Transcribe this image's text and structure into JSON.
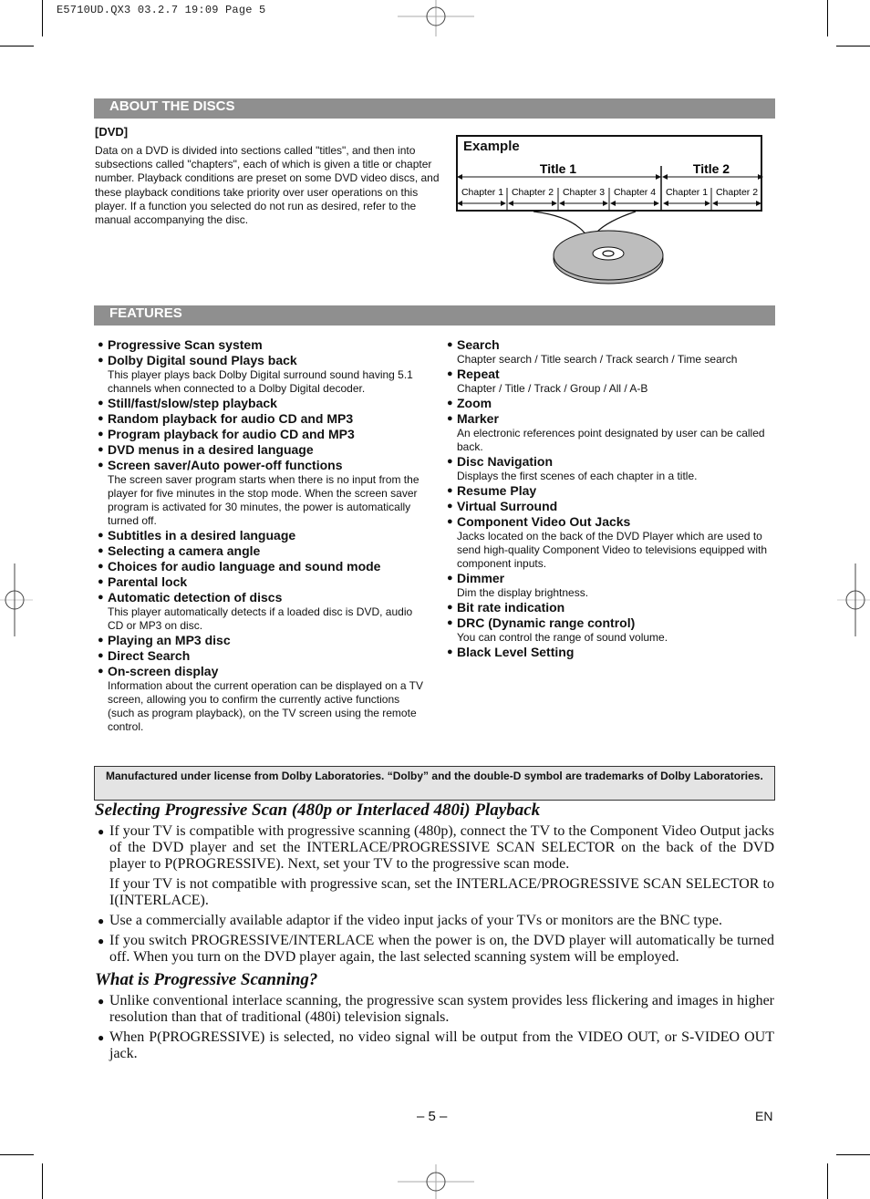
{
  "slug": "E5710UD.QX3  03.2.7 19:09  Page 5",
  "about": {
    "heading": "ABOUT THE DISCS",
    "dvd_label": "[DVD]",
    "dvd_text": "Data on a DVD is divided into sections called \"titles\", and then into subsections called \"chapters\", each of which is given a title or chapter number. Playback conditions are preset on some DVD video discs, and these playback conditions take priority over user operations on this player. If a function you selected do not run as desired, refer to the manual accompanying the disc.",
    "example": {
      "label": "Example",
      "titles": [
        "Title 1",
        "Title 2"
      ],
      "chapters": [
        "Chapter 1",
        "Chapter 2",
        "Chapter 3",
        "Chapter 4",
        "Chapter 1",
        "Chapter 2"
      ],
      "disc_icon": "dvd-disc-icon"
    }
  },
  "features": {
    "heading": "FEATURES",
    "left": [
      {
        "title": "Progressive Scan system",
        "desc": ""
      },
      {
        "title": "Dolby Digital sound Plays back",
        "desc": "This player plays back Dolby Digital surround sound having 5.1 channels when connected to a Dolby Digital decoder."
      },
      {
        "title": "Still/fast/slow/step playback",
        "desc": ""
      },
      {
        "title": "Random playback for audio CD and MP3",
        "desc": ""
      },
      {
        "title": "Program playback for audio CD and MP3",
        "desc": ""
      },
      {
        "title": "DVD menus in a desired language",
        "desc": ""
      },
      {
        "title": "Screen saver/Auto power-off functions",
        "desc": "The screen saver program starts when there is no input from the player for five minutes in the stop mode.  When the screen saver program is activated for 30 minutes, the power is automatically turned off."
      },
      {
        "title": "Subtitles in a desired language",
        "desc": ""
      },
      {
        "title": "Selecting a camera angle",
        "desc": ""
      },
      {
        "title": "Choices for audio language and sound mode",
        "desc": ""
      },
      {
        "title": "Parental lock",
        "desc": ""
      },
      {
        "title": "Automatic detection of discs",
        "desc": "This player automatically detects if a loaded disc is DVD, audio CD or MP3 on disc."
      },
      {
        "title": "Playing an MP3 disc",
        "desc": ""
      },
      {
        "title": "Direct Search",
        "desc": ""
      },
      {
        "title": "On-screen display",
        "desc": "Information about the current operation can be displayed on a TV screen, allowing you to confirm the currently active functions (such as program playback), on the TV screen using the remote control."
      }
    ],
    "right": [
      {
        "title": "Search",
        "desc": "Chapter search / Title search / Track search / Time search"
      },
      {
        "title": "Repeat",
        "desc": "Chapter / Title / Track / Group / All / A-B"
      },
      {
        "title": "Zoom",
        "desc": ""
      },
      {
        "title": "Marker",
        "desc": "An electronic references point designated by user can be called back."
      },
      {
        "title": "Disc Navigation",
        "desc": "Displays the first scenes of each chapter in a title."
      },
      {
        "title": "Resume Play",
        "desc": ""
      },
      {
        "title": "Virtual Surround",
        "desc": ""
      },
      {
        "title": "Component Video Out Jacks",
        "desc": "Jacks located on the back of the DVD Player which are used to send high-quality Component Video to televisions equipped with component inputs."
      },
      {
        "title": "Dimmer",
        "desc": "Dim the display brightness."
      },
      {
        "title": "Bit rate indication",
        "desc": ""
      },
      {
        "title": "DRC (Dynamic range control)",
        "desc": "You can control the range of sound volume."
      },
      {
        "title": "Black Level Setting",
        "desc": ""
      }
    ]
  },
  "dolby_notice": "Manufactured under license from Dolby Laboratories. “Dolby” and the double-D symbol are trademarks of Dolby Laboratories.",
  "progressive": {
    "heading": "Selecting Progressive Scan (480p or Interlaced 480i) Playback",
    "items": [
      {
        "paras": [
          "If your TV is compatible with progressive scanning (480p), connect the TV to the Component Video Output jacks of the DVD player and set the INTERLACE/PROGRESSIVE SCAN SELECTOR on the back of the DVD player to P(PROGRESSIVE). Next, set your TV to the progressive scan mode.",
          "If your TV is not compatible with progressive scan, set the INTERLACE/PROGRESSIVE SCAN SELECTOR to I(INTERLACE)."
        ]
      },
      {
        "paras": [
          "Use a commercially available adaptor if the video input jacks of your TVs or monitors are the BNC type."
        ]
      },
      {
        "paras": [
          "If you switch PROGRESSIVE/INTERLACE when the power is on, the DVD player will automatically be turned off. When you turn on the DVD player again, the last selected scanning system will be employed."
        ]
      }
    ]
  },
  "what_is": {
    "heading": "What is Progressive Scanning?",
    "items": [
      "Unlike conventional interlace scanning, the progressive scan system provides less flickering and images in higher resolution than that of traditional (480i) television signals.",
      "When P(PROGRESSIVE) is selected, no video signal will be output from the VIDEO OUT, or S-VIDEO OUT jack."
    ]
  },
  "footer": {
    "page_number": "– 5 –",
    "language": "EN"
  },
  "bullet_glyph": "●"
}
